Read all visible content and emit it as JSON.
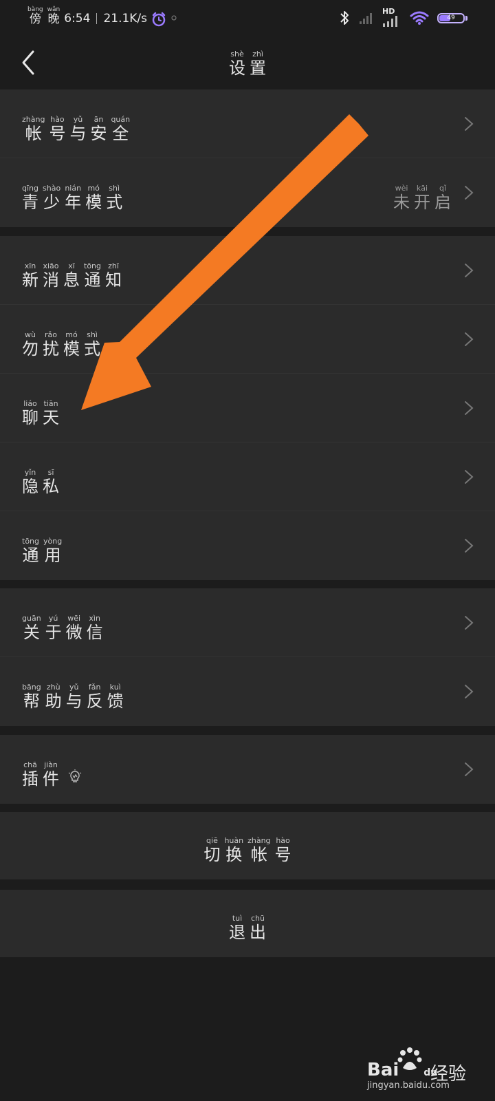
{
  "status_bar": {
    "time_prefix_pinyin": [
      "bàng",
      "wǎn"
    ],
    "time_prefix": [
      "傍",
      "晚"
    ],
    "time": "6:54",
    "net_speed": "21.1K/s",
    "network_label": "HD",
    "battery_percent": 49,
    "battery_text": "49",
    "accent_color": "#9b7bff"
  },
  "header": {
    "title": [
      {
        "py": "shè",
        "hz": "设"
      },
      {
        "py": "zhì",
        "hz": "置"
      }
    ],
    "back_icon": "chevron-left-icon"
  },
  "items": {
    "account_security": [
      {
        "py": "zhàng",
        "hz": "帐"
      },
      {
        "py": "hào",
        "hz": "号"
      },
      {
        "py": "yǔ",
        "hz": "与"
      },
      {
        "py": "ān",
        "hz": "安"
      },
      {
        "py": "quán",
        "hz": "全"
      }
    ],
    "teen_mode": [
      {
        "py": "qīng",
        "hz": "青"
      },
      {
        "py": "shào",
        "hz": "少"
      },
      {
        "py": "nián",
        "hz": "年"
      },
      {
        "py": "mó",
        "hz": "模"
      },
      {
        "py": "shì",
        "hz": "式"
      }
    ],
    "teen_mode_value": [
      {
        "py": "wèi",
        "hz": "未"
      },
      {
        "py": "kāi",
        "hz": "开"
      },
      {
        "py": "qǐ",
        "hz": "启"
      }
    ],
    "new_message_notify": [
      {
        "py": "xīn",
        "hz": "新"
      },
      {
        "py": "xiāo",
        "hz": "消"
      },
      {
        "py": "xī",
        "hz": "息"
      },
      {
        "py": "tōng",
        "hz": "通"
      },
      {
        "py": "zhī",
        "hz": "知"
      }
    ],
    "do_not_disturb": [
      {
        "py": "wù",
        "hz": "勿"
      },
      {
        "py": "rǎo",
        "hz": "扰"
      },
      {
        "py": "mó",
        "hz": "模"
      },
      {
        "py": "shì",
        "hz": "式"
      }
    ],
    "chat": [
      {
        "py": "liáo",
        "hz": "聊"
      },
      {
        "py": "tiān",
        "hz": "天"
      }
    ],
    "privacy": [
      {
        "py": "yǐn",
        "hz": "隐"
      },
      {
        "py": "sī",
        "hz": "私"
      }
    ],
    "general": [
      {
        "py": "tōng",
        "hz": "通"
      },
      {
        "py": "yòng",
        "hz": "用"
      }
    ],
    "about_wechat": [
      {
        "py": "guān",
        "hz": "关"
      },
      {
        "py": "yú",
        "hz": "于"
      },
      {
        "py": "wēi",
        "hz": "微"
      },
      {
        "py": "xìn",
        "hz": "信"
      }
    ],
    "help_feedback": [
      {
        "py": "bāng",
        "hz": "帮"
      },
      {
        "py": "zhù",
        "hz": "助"
      },
      {
        "py": "yǔ",
        "hz": "与"
      },
      {
        "py": "fǎn",
        "hz": "反"
      },
      {
        "py": "kuì",
        "hz": "馈"
      }
    ],
    "plugins": [
      {
        "py": "chā",
        "hz": "插"
      },
      {
        "py": "jiàn",
        "hz": "件"
      }
    ],
    "switch_account": [
      {
        "py": "qiē",
        "hz": "切"
      },
      {
        "py": "huàn",
        "hz": "换"
      },
      {
        "py": "zhàng",
        "hz": "帐"
      },
      {
        "py": "hào",
        "hz": "号"
      }
    ],
    "logout": [
      {
        "py": "tuì",
        "hz": "退"
      },
      {
        "py": "chū",
        "hz": "出"
      }
    ]
  },
  "annotation": {
    "arrow_color": "#f47a23"
  },
  "watermark": {
    "brand_latin": "Bai",
    "brand_suffix": "du",
    "brand_cn": "经验",
    "url": "jingyan.baidu.com"
  }
}
